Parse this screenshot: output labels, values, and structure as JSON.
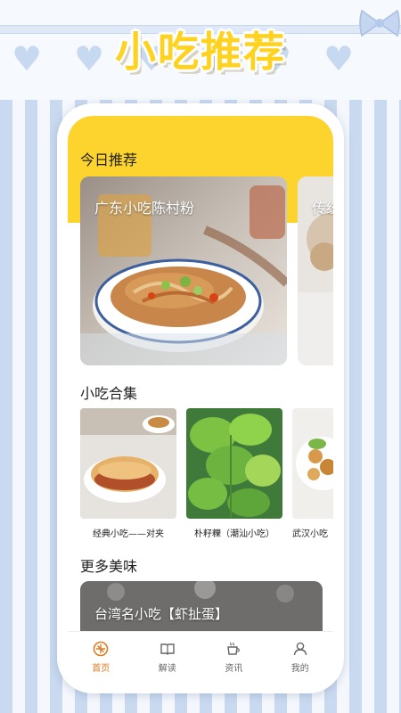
{
  "banner": {
    "title": "小吃推荐"
  },
  "today": {
    "title": "今日推荐",
    "cards": [
      {
        "label": "广东小吃陈村粉"
      },
      {
        "label": "传统"
      }
    ]
  },
  "collection": {
    "title": "小吃合集",
    "items": [
      {
        "label": "经典小吃——对夹"
      },
      {
        "label": "朴籽粿（潮汕小吃）"
      },
      {
        "label": "武汉小吃"
      }
    ]
  },
  "more": {
    "title": "更多美味",
    "card_label": "台湾名小吃【虾扯蛋】"
  },
  "tabbar": {
    "tabs": [
      {
        "label": "首页",
        "icon": "home-icon",
        "active": true
      },
      {
        "label": "解读",
        "icon": "book-icon",
        "active": false
      },
      {
        "label": "资讯",
        "icon": "coffee-cup-icon",
        "active": false
      },
      {
        "label": "我的",
        "icon": "user-icon",
        "active": false
      }
    ]
  },
  "colors": {
    "accent_yellow": "#fdd32e",
    "active_tab": "#e07a1f",
    "stripe_blue": "#c9d9ef"
  }
}
